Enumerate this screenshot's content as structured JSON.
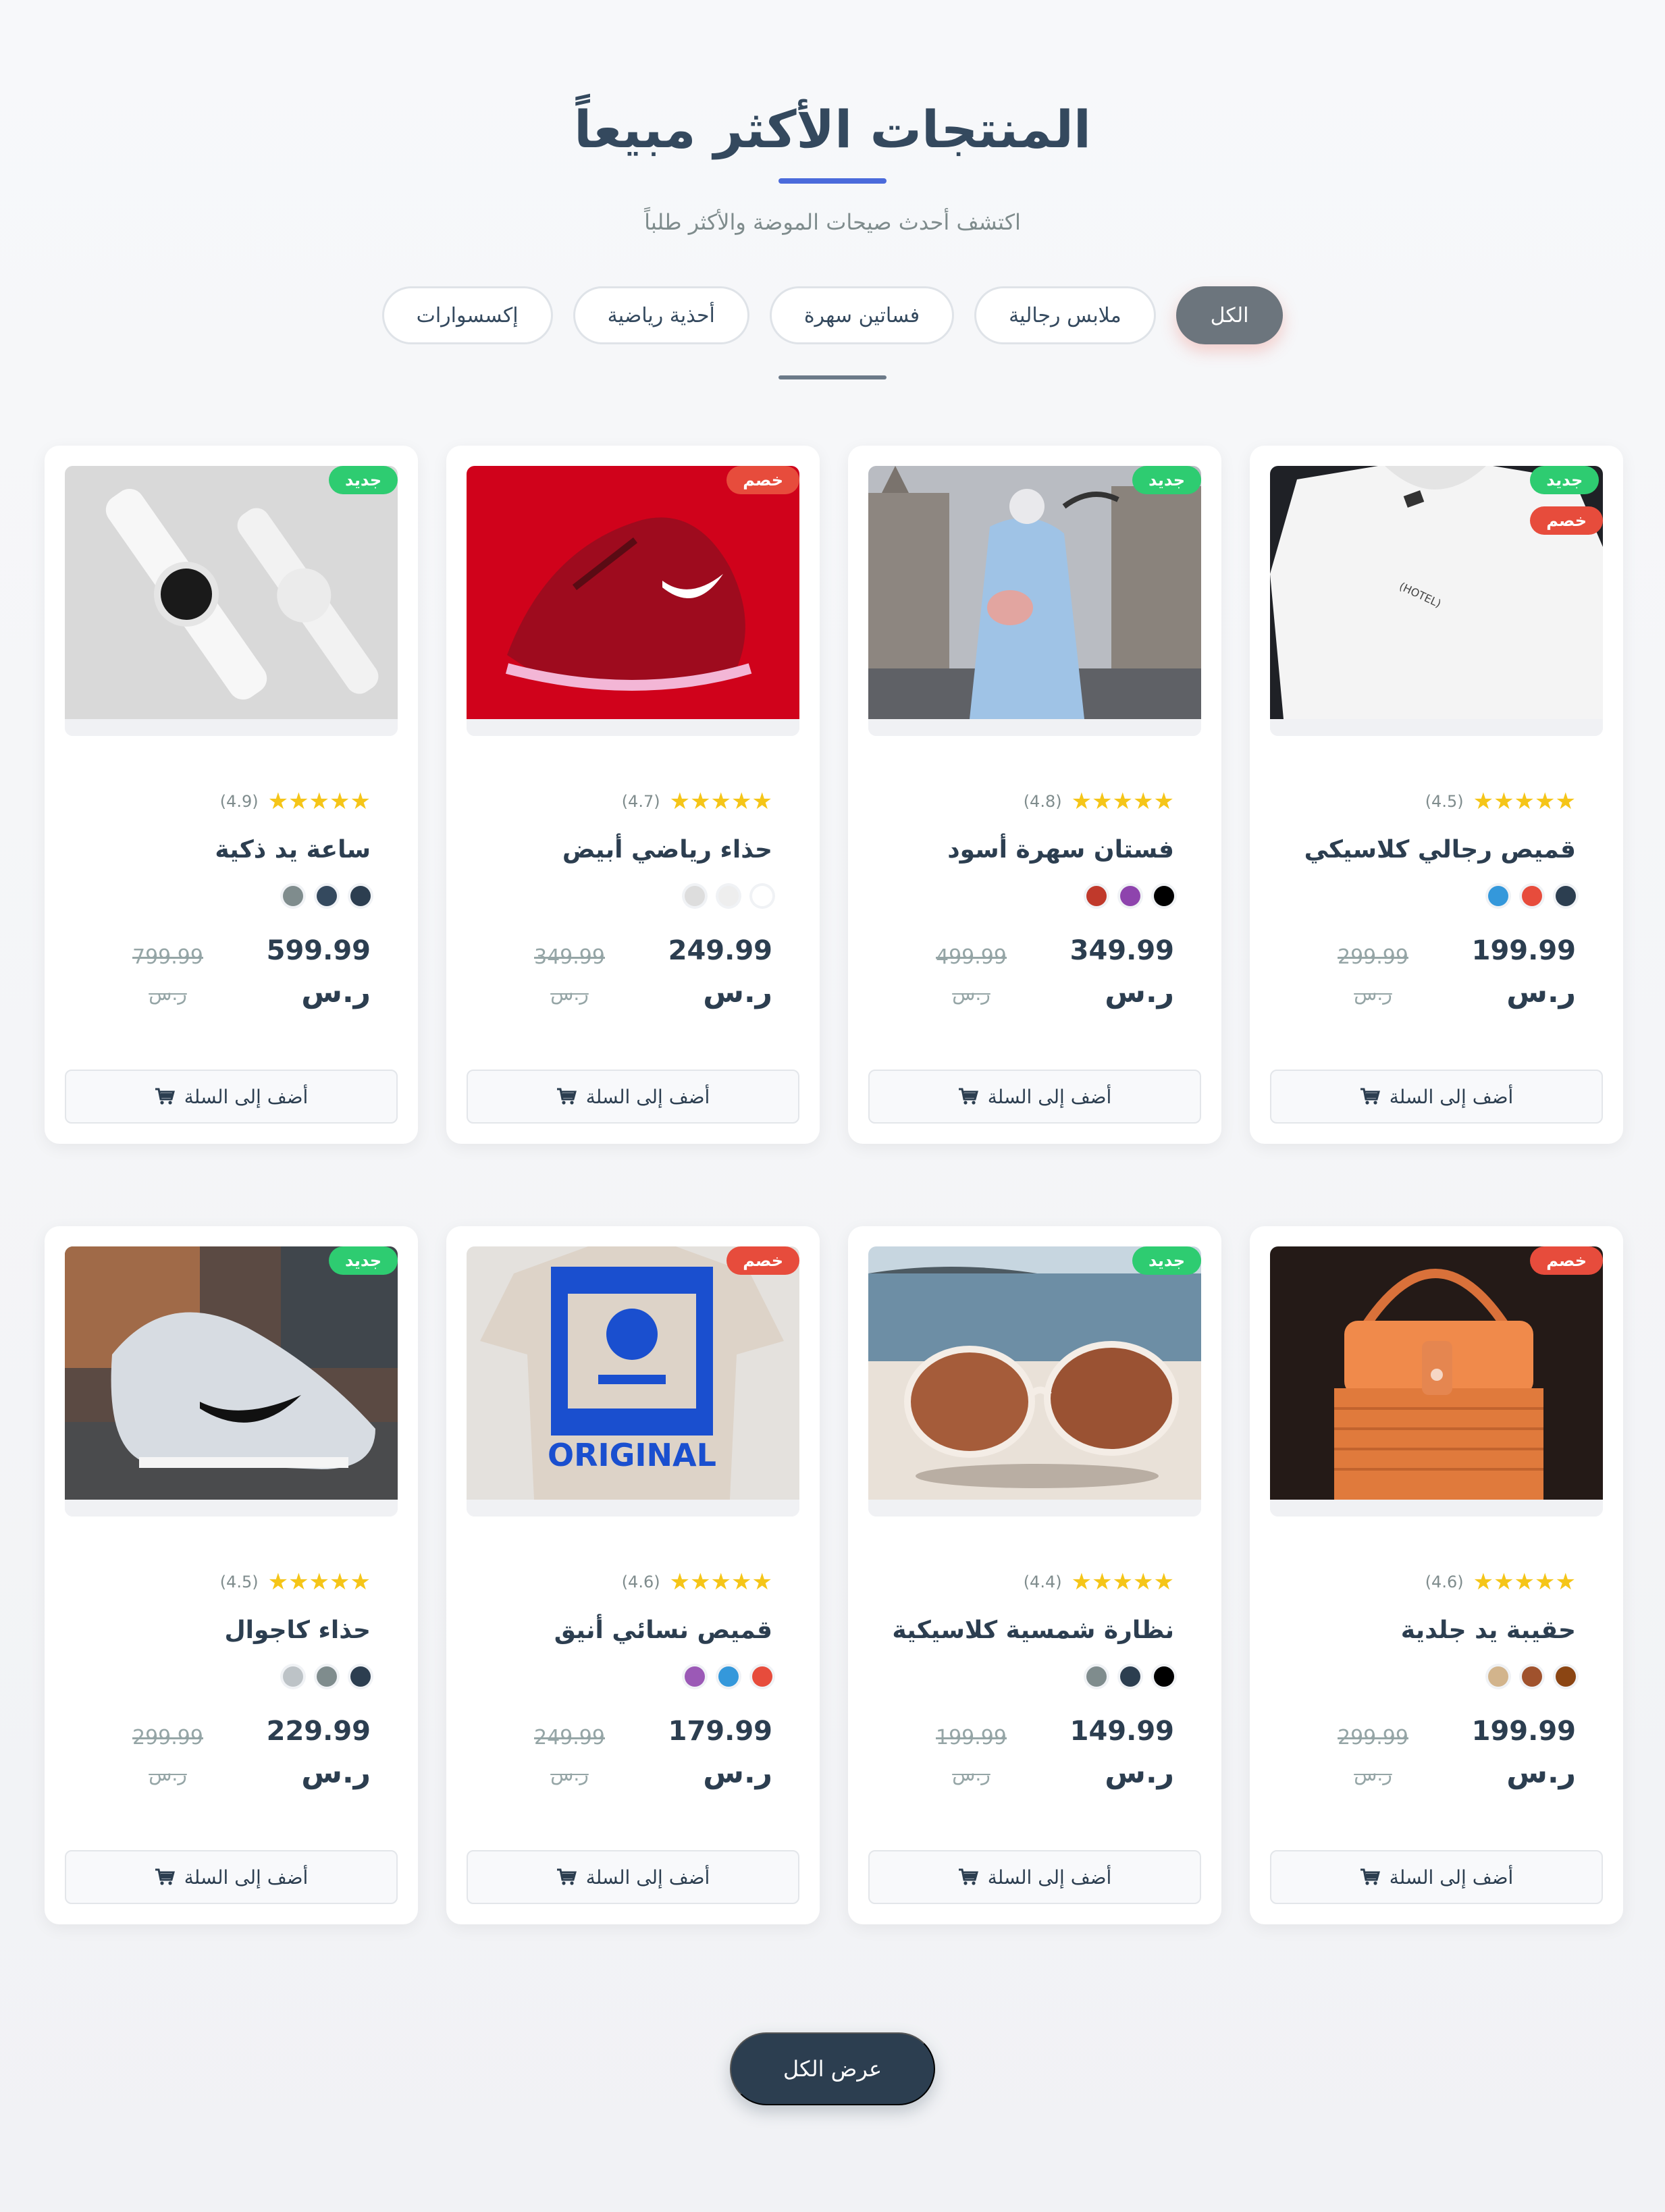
{
  "header": {
    "title": "المنتجات الأكثر مبيعاً",
    "subtitle": "اكتشف أحدث صيحات الموضة والأكثر طلباً"
  },
  "filters": [
    "الكل",
    "ملابس رجالية",
    "فساتين سهرة",
    "أحذية رياضية",
    "إكسسوارات"
  ],
  "active_filter": "الكل",
  "cart_label": "أضف إلى السلة",
  "currency": "ر.س",
  "badges": {
    "new": "جديد",
    "sale": "خصم"
  },
  "products": [
    {
      "name": "قميص رجالي كلاسيكي",
      "rating": "(4.5)",
      "price": "199.99",
      "old_price": "299.99",
      "badges": [
        "new",
        "sale"
      ],
      "colors": [
        "#2c3e50",
        "#e74c3c",
        "#3498db"
      ],
      "image": "white-tshirt"
    },
    {
      "name": "فستان سهرة أسود",
      "rating": "(4.8)",
      "price": "349.99",
      "old_price": "499.99",
      "badges": [
        "new"
      ],
      "colors": [
        "#000000",
        "#8e44ad",
        "#c0392b"
      ],
      "image": "woman-coat"
    },
    {
      "name": "حذاء رياضي أبيض",
      "rating": "(4.7)",
      "price": "249.99",
      "old_price": "349.99",
      "badges": [
        "sale"
      ],
      "colors": [
        "#ffffff",
        "#eeeeee",
        "#dddddd"
      ],
      "image": "red-sneaker"
    },
    {
      "name": "ساعة يد ذكية",
      "rating": "(4.9)",
      "price": "599.99",
      "old_price": "799.99",
      "badges": [
        "new"
      ],
      "colors": [
        "#2c3e50",
        "#34495e",
        "#7f8c8d"
      ],
      "image": "smart-watch"
    },
    {
      "name": "حقيبة يد جلدية",
      "rating": "(4.6)",
      "price": "199.99",
      "old_price": "299.99",
      "badges": [
        "sale"
      ],
      "colors": [
        "#8b4513",
        "#a0522d",
        "#d2b48c"
      ],
      "image": "orange-handbag"
    },
    {
      "name": "نظارة شمسية كلاسيكية",
      "rating": "(4.4)",
      "price": "149.99",
      "old_price": "199.99",
      "badges": [
        "new"
      ],
      "colors": [
        "#000000",
        "#2c3e50",
        "#7f8c8d"
      ],
      "image": "sunglasses"
    },
    {
      "name": "قميص نسائي أنيق",
      "rating": "(4.6)",
      "price": "179.99",
      "old_price": "249.99",
      "badges": [
        "sale"
      ],
      "colors": [
        "#e74c3c",
        "#3498db",
        "#9b59b6"
      ],
      "image": "printed-tshirt"
    },
    {
      "name": "حذاء كاجوال",
      "rating": "(4.5)",
      "price": "229.99",
      "old_price": "299.99",
      "badges": [
        "new"
      ],
      "colors": [
        "#2c3e50",
        "#7f8c8d",
        "#bdc3c7"
      ],
      "image": "grey-sneaker"
    }
  ],
  "view_all": "عرض الكل"
}
